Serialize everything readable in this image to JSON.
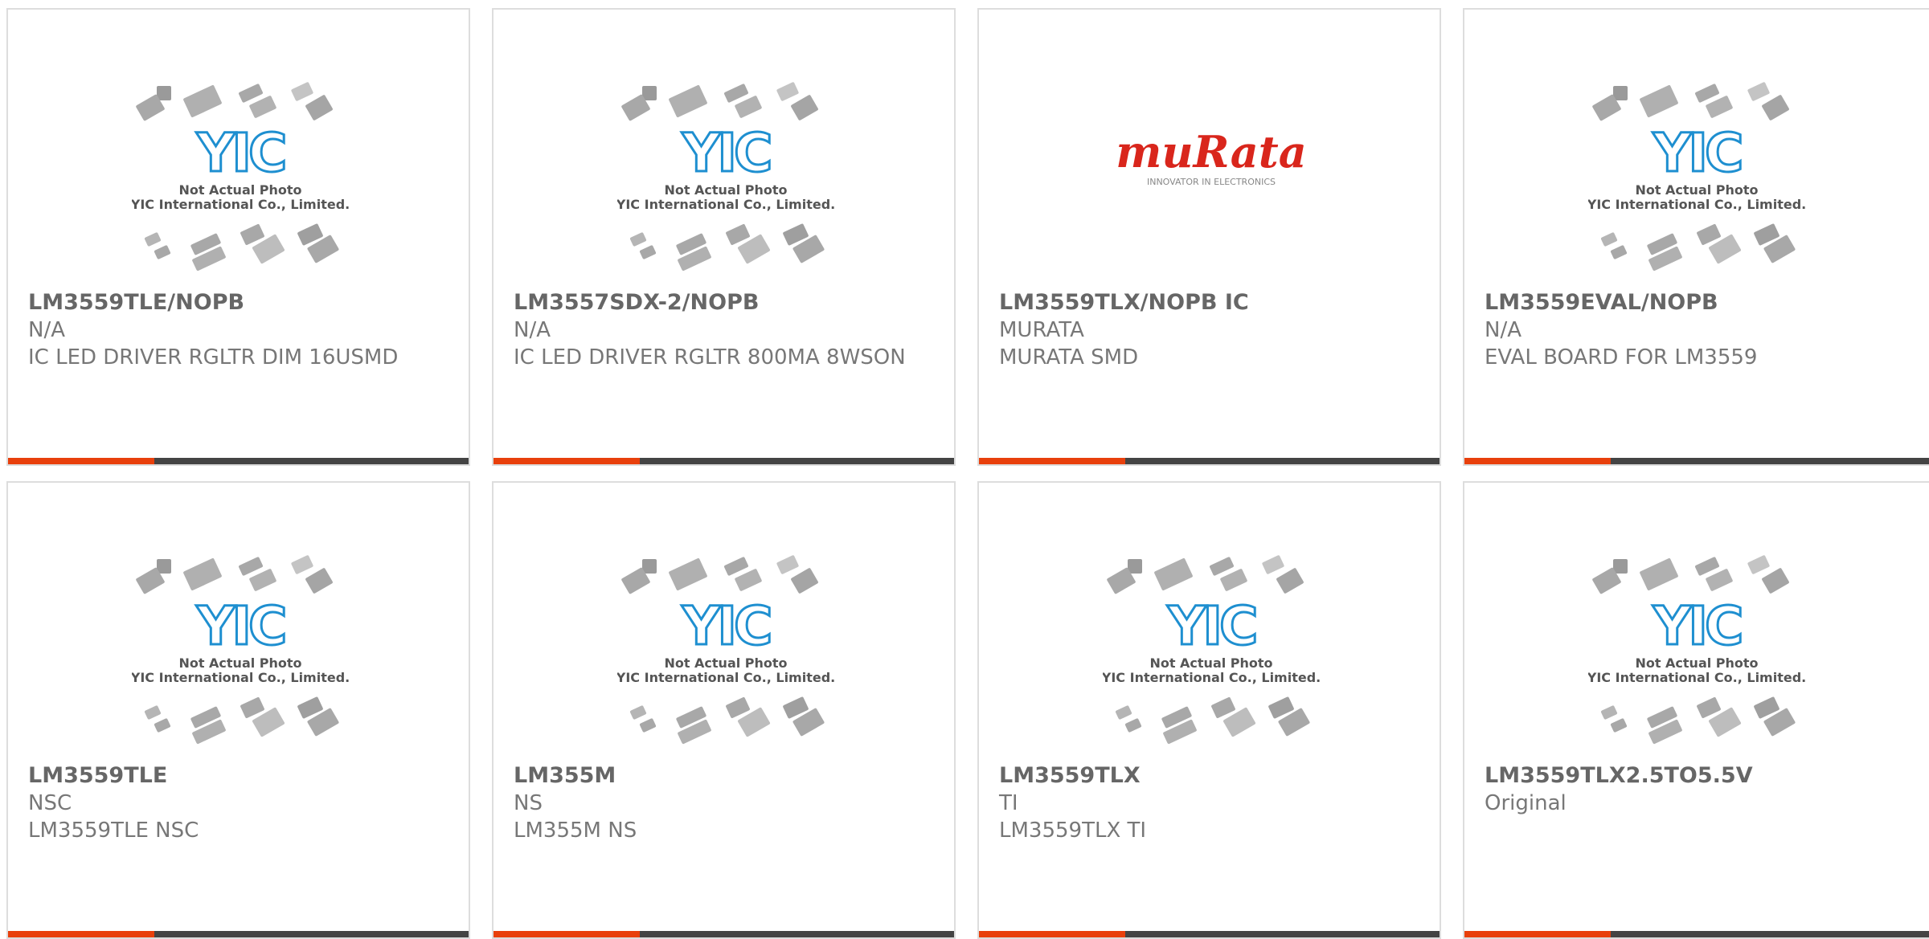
{
  "colors": {
    "accent": "#e8400c",
    "bar": "#444444",
    "yic_blue": "#1e8fd0",
    "murata_red": "#d9261c"
  },
  "placeholder": {
    "line1": "Not Actual Photo",
    "line2": "YIC International Co., Limited.",
    "logo_text": "YIC"
  },
  "murata": {
    "logo_text": "muRata",
    "tagline": "INNOVATOR IN ELECTRONICS"
  },
  "products": [
    {
      "part": "LM3559TLE/NOPB",
      "brand": "N/A",
      "desc": "IC LED DRIVER RGLTR DIM 16USMD",
      "image": "yic-placeholder"
    },
    {
      "part": "LM3557SDX-2/NOPB",
      "brand": "N/A",
      "desc": "IC LED DRIVER RGLTR 800MA 8WSON",
      "image": "yic-placeholder"
    },
    {
      "part": "LM3559TLX/NOPB IC",
      "brand": "MURATA",
      "desc": "MURATA SMD",
      "image": "murata-logo"
    },
    {
      "part": "LM3559EVAL/NOPB",
      "brand": "N/A",
      "desc": "EVAL BOARD FOR LM3559",
      "image": "yic-placeholder"
    },
    {
      "part": "LM3559TLE",
      "brand": "NSC",
      "desc": "LM3559TLE NSC",
      "image": "yic-placeholder"
    },
    {
      "part": "LM355M",
      "brand": "NS",
      "desc": "LM355M NS",
      "image": "yic-placeholder"
    },
    {
      "part": "LM3559TLX",
      "brand": "TI",
      "desc": "LM3559TLX TI",
      "image": "yic-placeholder"
    },
    {
      "part": "LM3559TLX2.5TO5.5V",
      "brand": "Original",
      "desc": "",
      "image": "yic-placeholder"
    }
  ]
}
